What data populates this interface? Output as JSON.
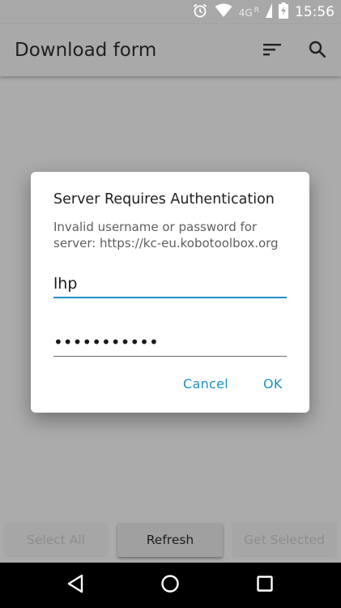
{
  "status_bar": {
    "network": "4G",
    "roaming": "R",
    "time": "15:56",
    "icons": [
      "alarm-icon",
      "wifi-icon",
      "signal-icon",
      "battery-charging-icon"
    ]
  },
  "app_bar": {
    "title": "Download form",
    "actions": [
      "sort-icon",
      "search-icon"
    ]
  },
  "dialog": {
    "title": "Server Requires Authentication",
    "message": "Invalid username or password for server: https://kc-eu.kobotoolbox.org",
    "username_value": "lhp",
    "password_value": "•••••••••••",
    "cancel_label": "Cancel",
    "ok_label": "OK",
    "accent_color": "#1f8fc9"
  },
  "bottom_bar": {
    "select_all_label": "Select All",
    "refresh_label": "Refresh",
    "get_selected_label": "Get Selected"
  },
  "nav_bar": {
    "buttons": [
      "back-icon",
      "home-icon",
      "recents-icon"
    ]
  }
}
